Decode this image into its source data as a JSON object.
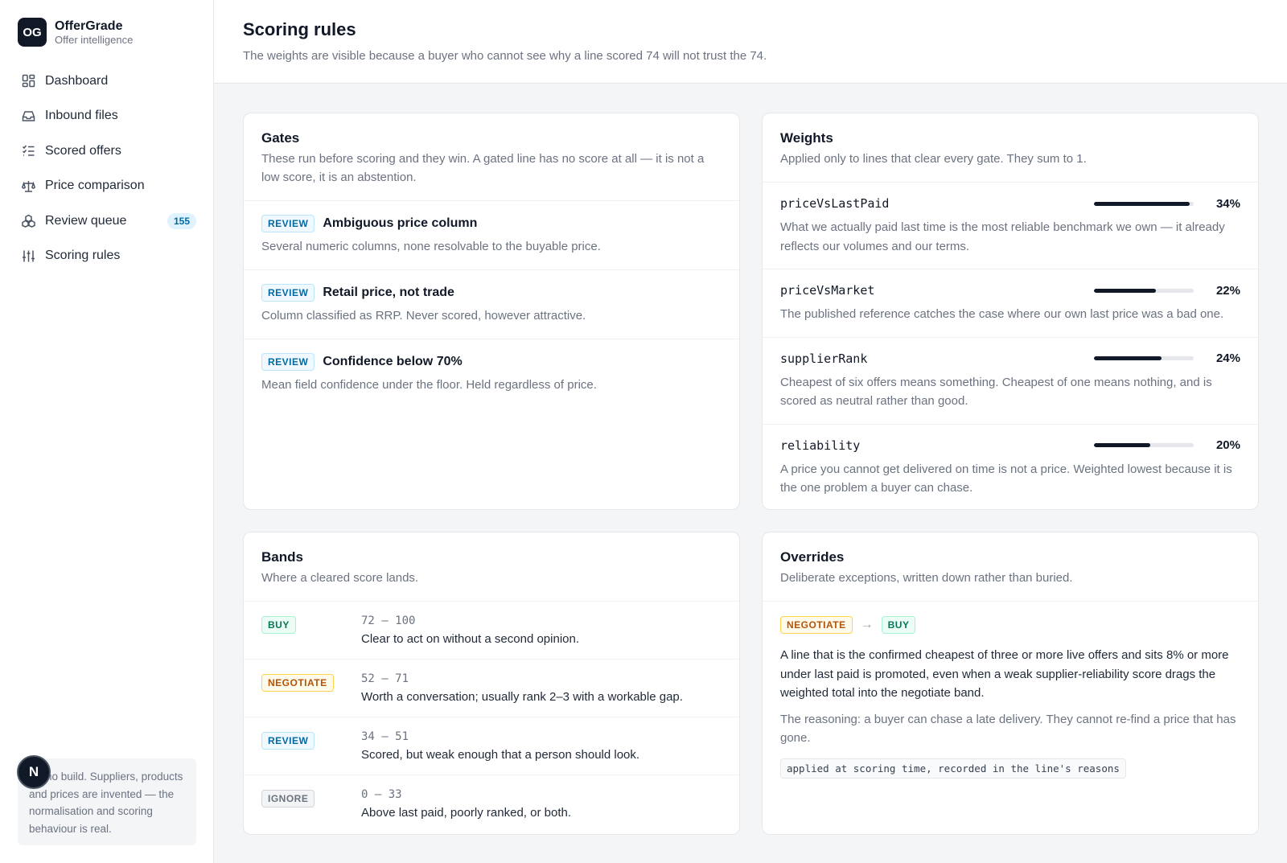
{
  "app": {
    "logo": "OG",
    "name": "OfferGrade",
    "tagline": "Offer intelligence"
  },
  "sidebar": {
    "items": [
      {
        "label": "Dashboard",
        "icon": "dashboard-icon"
      },
      {
        "label": "Inbound files",
        "icon": "inbox-icon"
      },
      {
        "label": "Scored offers",
        "icon": "checklist-icon"
      },
      {
        "label": "Price comparison",
        "icon": "scale-icon"
      },
      {
        "label": "Review queue",
        "icon": "boxes-icon",
        "badge": "155"
      },
      {
        "label": "Scoring rules",
        "icon": "sliders-icon"
      }
    ],
    "note": "Demo build. Suppliers, products and prices are invented — the normalisation and scoring behaviour is real.",
    "avatar": "N"
  },
  "header": {
    "title": "Scoring rules",
    "subtitle": "The weights are visible because a buyer who cannot see why a line scored 74 will not trust the 74."
  },
  "gates": {
    "title": "Gates",
    "desc": "These run before scoring and they win. A gated line has no score at all — it is not a low score, it is an abstention.",
    "items": [
      {
        "tag": "REVIEW",
        "title": "Ambiguous price column",
        "desc": "Several numeric columns, none resolvable to the buyable price."
      },
      {
        "tag": "REVIEW",
        "title": "Retail price, not trade",
        "desc": "Column classified as RRP. Never scored, however attractive."
      },
      {
        "tag": "REVIEW",
        "title": "Confidence below 70%",
        "desc": "Mean field confidence under the floor. Held regardless of price."
      }
    ]
  },
  "weights": {
    "title": "Weights",
    "desc": "Applied only to lines that clear every gate. They sum to 1.",
    "items": [
      {
        "key": "priceVsLastPaid",
        "value": 0.34,
        "label": "34%",
        "desc": "What we actually paid last time is the most reliable benchmark we own — it already reflects our volumes and our terms."
      },
      {
        "key": "priceVsMarket",
        "value": 0.22,
        "label": "22%",
        "desc": "The published reference catches the case where our own last price was a bad one."
      },
      {
        "key": "supplierRank",
        "value": 0.24,
        "label": "24%",
        "desc": "Cheapest of six offers means something. Cheapest of one means nothing, and is scored as neutral rather than good."
      },
      {
        "key": "reliability",
        "value": 0.2,
        "label": "20%",
        "desc": "A price you cannot get delivered on time is not a price. Weighted lowest because it is the one problem a buyer can chase."
      }
    ]
  },
  "bands": {
    "title": "Bands",
    "desc": "Where a cleared score lands.",
    "items": [
      {
        "tag": "BUY",
        "range": "72 – 100",
        "desc": "Clear to act on without a second opinion."
      },
      {
        "tag": "NEGOTIATE",
        "range": "52 – 71",
        "desc": "Worth a conversation; usually rank 2–3 with a workable gap."
      },
      {
        "tag": "REVIEW",
        "range": "34 – 51",
        "desc": "Scored, but weak enough that a person should look."
      },
      {
        "tag": "IGNORE",
        "range": "0 – 33",
        "desc": "Above last paid, poorly ranked, or both."
      }
    ]
  },
  "overrides": {
    "title": "Overrides",
    "desc": "Deliberate exceptions, written down rather than buried.",
    "from": "NEGOTIATE",
    "arrow": "→",
    "to": "BUY",
    "text": "A line that is the confirmed cheapest of three or more live offers and sits 8% or more under last paid is promoted, even when a weak supplier-reliability score drags the weighted total into the negotiate band.",
    "reason": "The reasoning: a buyer can chase a late delivery. They cannot re-find a price that has gone.",
    "code": "applied at scoring time, recorded in the line's reasons"
  },
  "colors": {
    "accent": "#111827",
    "review": "#0369a1",
    "buy": "#047857",
    "negotiate": "#b45309",
    "ignore": "#6b7280"
  }
}
